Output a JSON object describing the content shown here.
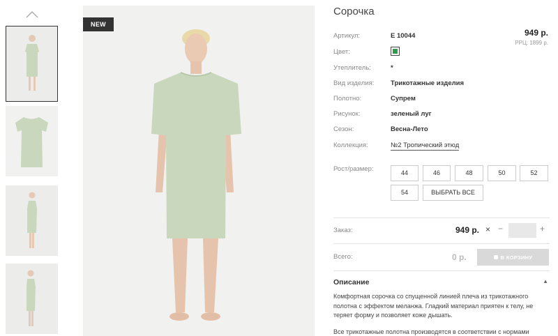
{
  "product": {
    "badge": "NEW",
    "title": "Сорочка",
    "price": "949 р.",
    "rrc": "РРЦ: 1899 р."
  },
  "specs": [
    {
      "label": "Артикул:",
      "value": "Е 10044"
    },
    {
      "label": "Цвет:",
      "value": ""
    },
    {
      "label": "Утеплитель:",
      "value": "*"
    },
    {
      "label": "Вид изделия:",
      "value": "Трикотажные изделия"
    },
    {
      "label": "Полотно:",
      "value": "Супрем"
    },
    {
      "label": "Рисунок:",
      "value": "зеленый луг"
    },
    {
      "label": "Сезон:",
      "value": "Весна-Лето"
    },
    {
      "label": "Коллекция:",
      "value": "№2 Тропический этюд"
    }
  ],
  "colors": {
    "swatch": "#2e9b4c",
    "product": "#c9d8bd"
  },
  "sizes": {
    "label": "Рост/размер:",
    "options": [
      "44",
      "46",
      "48",
      "50",
      "52",
      "54"
    ],
    "select_all": "ВЫБРАТЬ ВСЕ"
  },
  "order": {
    "label": "Заказ:",
    "price": "949 р.",
    "multiply": "×",
    "minus": "−",
    "plus": "+",
    "qty": ""
  },
  "total": {
    "label": "Всего:",
    "value": "0 р.",
    "cart_button": "В КОРЗИНУ"
  },
  "description": {
    "title": "Описание",
    "toggle": "▲",
    "text": "Комфортная сорочка со спущенной линией плеча из трикотажного полотна с эффектом меланжа. Гладкий материал приятен к телу, не теряет форму и позволяет коже дышать.",
    "text2": "Все трикотажные полотна производятся в соответствии с нормами"
  },
  "icons": {
    "scroll_up": "chevron-up-icon",
    "cart": "cart-icon"
  }
}
